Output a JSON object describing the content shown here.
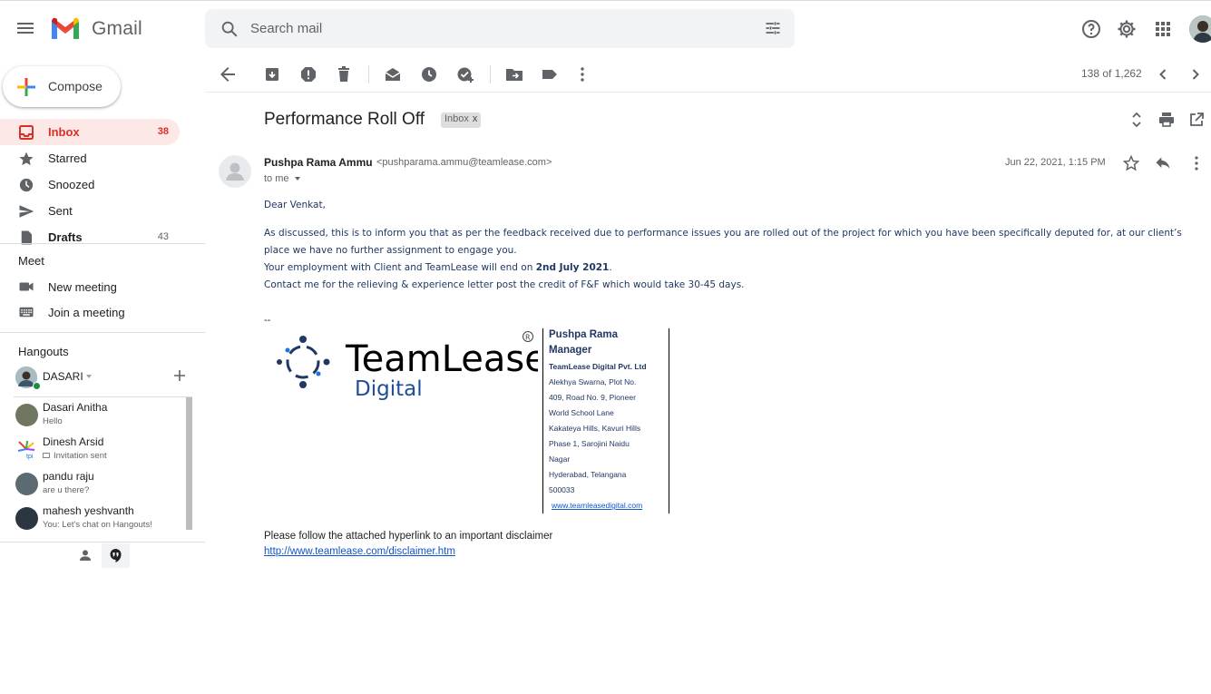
{
  "app": {
    "name": "Gmail"
  },
  "search": {
    "placeholder": "Search mail"
  },
  "sidebar": {
    "compose_label": "Compose",
    "items": [
      {
        "label": "Inbox",
        "count": "38",
        "icon": "inbox-icon"
      },
      {
        "label": "Starred",
        "count": "",
        "icon": "star-icon"
      },
      {
        "label": "Snoozed",
        "count": "",
        "icon": "clock-icon"
      },
      {
        "label": "Sent",
        "count": "",
        "icon": "send-icon"
      },
      {
        "label": "Drafts",
        "count": "43",
        "icon": "draft-icon"
      }
    ]
  },
  "meet": {
    "title": "Meet",
    "items": [
      {
        "label": "New meeting",
        "icon": "video-icon"
      },
      {
        "label": "Join a meeting",
        "icon": "keyboard-icon"
      }
    ]
  },
  "hangouts": {
    "title": "Hangouts",
    "user": "DASARI",
    "contacts": [
      {
        "name": "Dasari Anitha",
        "message": "Hello"
      },
      {
        "name": "Dinesh Arsid",
        "message": "Invitation sent"
      },
      {
        "name": "pandu raju",
        "message": "are u there?"
      },
      {
        "name": "mahesh yeshvanth",
        "message": "You: Let's chat on Hangouts!"
      }
    ]
  },
  "toolbar": {
    "pager": "138 of 1,262"
  },
  "message": {
    "subject": "Performance Roll Off",
    "label": "Inbox",
    "label_close": "x",
    "sender_name": "Pushpa Rama Ammu",
    "sender_email": "<pushparama.ammu@teamlease.com>",
    "to": "to me",
    "date": "Jun 22, 2021, 1:15 PM",
    "greeting": "Dear Venkat,",
    "para1": "As discussed, this is to inform you that as per the feedback received due to performance issues you are rolled out of the project for which you have been specifically deputed for, at our client’s place we have no further assignment to engage you.",
    "para2_prefix": "Your employment with Client and TeamLease will end on ",
    "para2_bold": "2nd July 2021",
    "para2_suffix": ".",
    "para3": "Contact me for the relieving & experience letter post the credit of F&F which would take 30-45 days.",
    "sig_dash": "--",
    "logo_text_1": "TeamLease",
    "logo_text_2": "Digital",
    "logo_mark": "R",
    "signature": {
      "name": "Pushpa Rama",
      "title": "Manager",
      "company": "TeamLease Digital Pvt. Ltd",
      "address_lines": [
        "Alekhya Swarna, Plot No.",
        "409, Road No. 9, Pioneer",
        "World School Lane",
        "Kakateya Hills, Kavuri Hills",
        "Phase 1, Sarojini Naidu",
        "Nagar",
        "Hyderabad, Telangana",
        "500033"
      ],
      "url": "www.teamleasedigital.com"
    },
    "disclaimer_text": "Please follow the attached hyperlink to an important disclaimer",
    "disclaimer_link": "http://www.teamlease.com/disclaimer.htm"
  },
  "colors": {
    "accent_red": "#d93025",
    "active_bg": "#fce8e6",
    "body_text": "#1f3864",
    "link": "#1155cc"
  }
}
